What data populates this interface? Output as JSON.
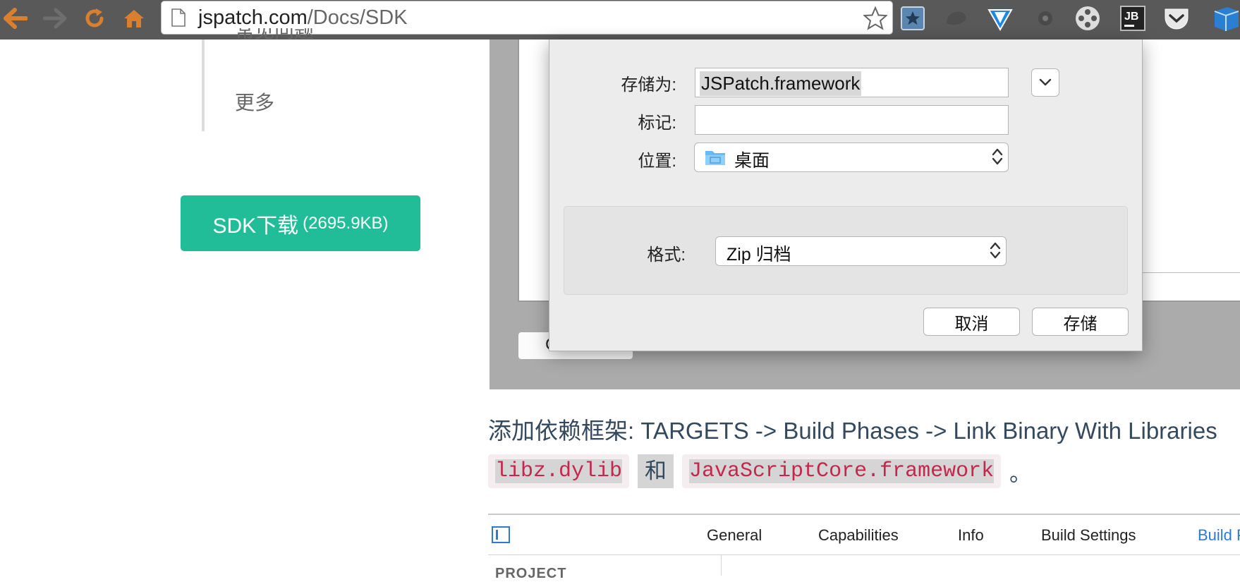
{
  "browser": {
    "url_host": "jspatch.com",
    "url_path": "/Docs/SDK",
    "colors": {
      "toolbar": "#595959",
      "nav_icon": "#d98030"
    }
  },
  "sidebar": {
    "cut_item": "常见问题",
    "more": "更多",
    "sdk_button": {
      "label": "SDK下载",
      "size": "(2695.9KB)",
      "color": "#21bd98"
    }
  },
  "save_dialog": {
    "save_as_label": "存储为:",
    "save_as_value": "JSPatch.framework",
    "tags_label": "标记:",
    "tags_value": "",
    "where_label": "位置:",
    "where_value": "桌面",
    "format_label": "格式:",
    "format_value": "Zip 归档",
    "cancel": "取消",
    "save": "存储",
    "behind_button": "Choose"
  },
  "doc": {
    "add_deps_prefix": "添加依赖框架: ",
    "add_deps_path": "TARGETS -> Build Phases -> Link Binary With Libraries",
    "code1": "libz.dylib",
    "and": "和",
    "code2": "JavaScriptCore.framework",
    "period": "。"
  },
  "xcode": {
    "tabs": [
      "General",
      "Capabilities",
      "Info",
      "Build Settings",
      "Build Phases"
    ],
    "active_tab": "Build Phases",
    "project_label": "PROJECT",
    "accent": "#2c7ad6"
  }
}
